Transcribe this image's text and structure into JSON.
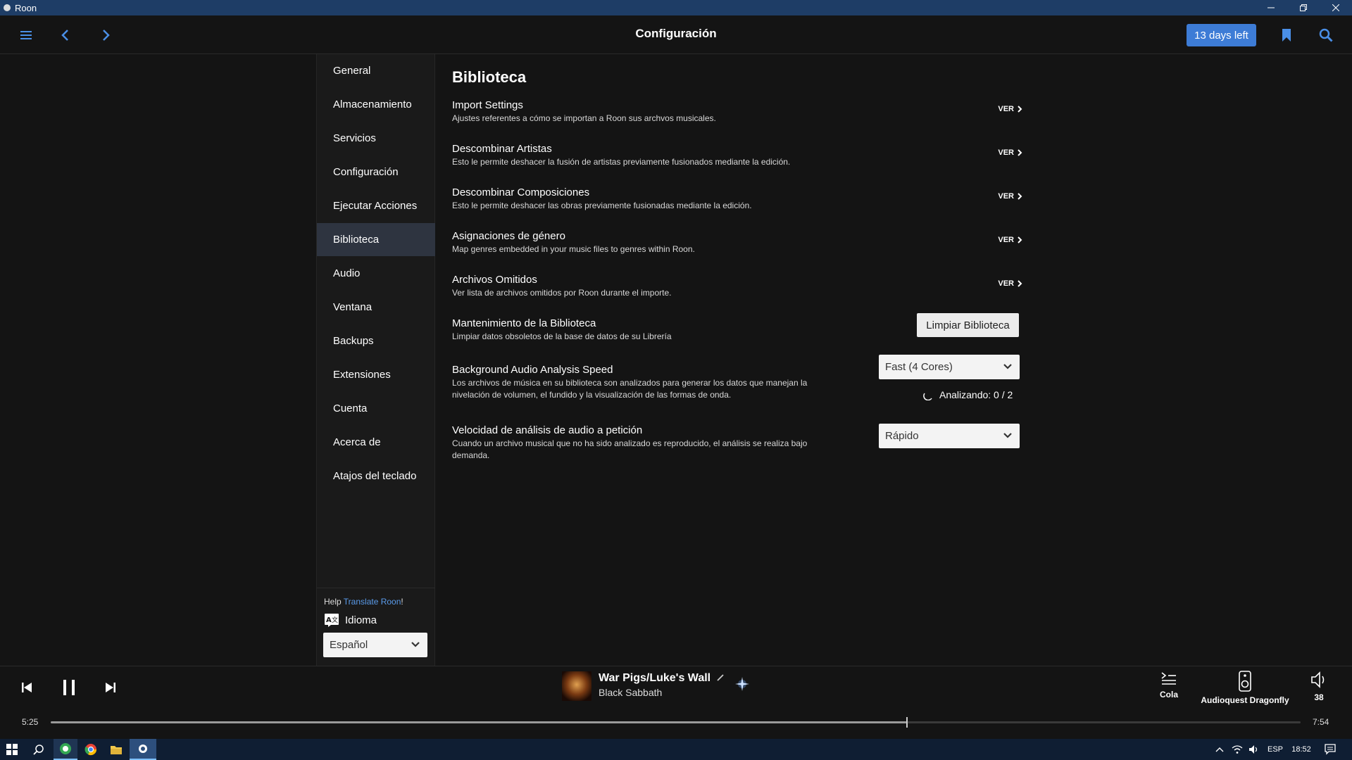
{
  "window": {
    "title": "Roon",
    "controls": [
      "minimize",
      "restore",
      "close"
    ]
  },
  "topbar": {
    "title": "Configuración",
    "trial_label": "13 days left",
    "icons": [
      "hamburger-icon",
      "back-icon",
      "forward-icon",
      "bookmark-icon",
      "search-icon"
    ]
  },
  "sidebar": {
    "items": [
      {
        "label": "General"
      },
      {
        "label": "Almacenamiento"
      },
      {
        "label": "Servicios"
      },
      {
        "label": "Configuración"
      },
      {
        "label": "Ejecutar Acciones"
      },
      {
        "label": "Biblioteca",
        "active": true
      },
      {
        "label": "Audio"
      },
      {
        "label": "Ventana"
      },
      {
        "label": "Backups"
      },
      {
        "label": "Extensiones"
      },
      {
        "label": "Cuenta"
      },
      {
        "label": "Acerca de"
      },
      {
        "label": "Atajos del teclado"
      }
    ],
    "help_prefix": "Help ",
    "help_link": "Translate Roon",
    "help_suffix": "!",
    "language_label": "Idioma",
    "language_value": "Español"
  },
  "main": {
    "section_title": "Biblioteca",
    "view_label": "VER",
    "rows": [
      {
        "title": "Import Settings",
        "desc": "Ajustes referentes a cómo se importan a Roon sus archvos musicales."
      },
      {
        "title": "Descombinar Artistas",
        "desc": "Esto le permite deshacer la fusión de artistas previamente fusionados mediante la edición."
      },
      {
        "title": "Descombinar Composiciones",
        "desc": "Esto le permite deshacer las obras previamente fusionadas mediante la edición."
      },
      {
        "title": "Asignaciones de género",
        "desc": "Map genres embedded in your music files to genres within Roon."
      },
      {
        "title": "Archivos Omitidos",
        "desc": "Ver lista de archivos omitidos por Roon durante el importe."
      }
    ],
    "maintenance": {
      "title": "Mantenimiento de la Biblioteca",
      "desc": "Limpiar datos obsoletos de la base de datos de su Librería",
      "button": "Limpiar Biblioteca"
    },
    "background_analysis": {
      "title": "Background Audio Analysis Speed",
      "desc_line1": "Los archivos de música en su biblioteca son analizados para generar los datos que manejan la",
      "desc_line2": "nivelación de volumen, el fundido y la visualización de las formas de onda.",
      "value": "Fast (4 Cores)",
      "status": "Analizando: 0 / 2"
    },
    "ondemand_analysis": {
      "title": "Velocidad de análisis de audio a petición",
      "desc_line1": "Cuando un archivo musical que no ha sido analizado es reproducido, el análisis se realiza bajo",
      "desc_line2": "demanda.",
      "value": "Rápido"
    }
  },
  "player": {
    "track_title": "War Pigs/Luke's Wall",
    "artist": "Black Sabbath",
    "elapsed": "5:25",
    "total": "7:54",
    "progress_fraction": 0.685,
    "queue_label": "Cola",
    "zone_label": "Audioquest Dragonfly",
    "volume": "38"
  },
  "taskbar": {
    "lang": "ESP",
    "time": "18:52"
  },
  "colors": {
    "accent": "#3d7cd6",
    "link": "#5a9bea",
    "titlebar": "#1e3d66",
    "taskbar": "#0f1e33",
    "active_nav": "#2e3440"
  }
}
